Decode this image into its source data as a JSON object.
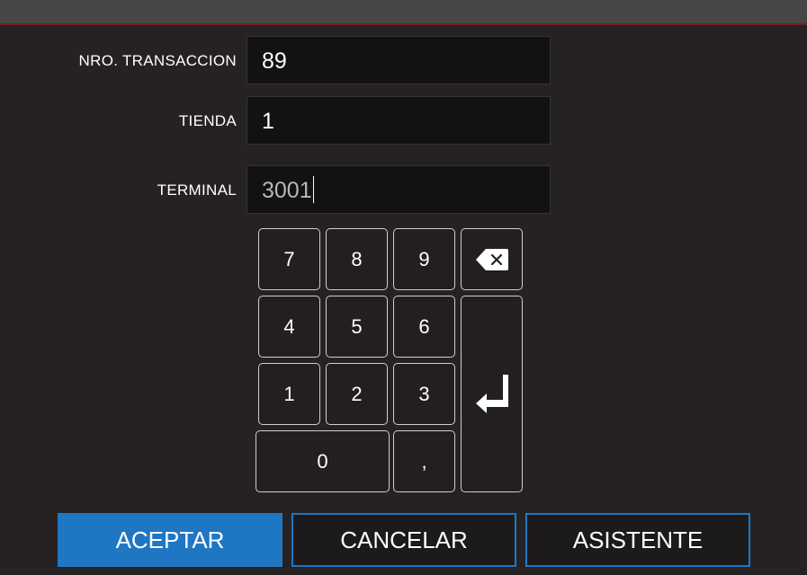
{
  "form": {
    "transaction": {
      "label": "NRO. TRANSACCION",
      "value": "89"
    },
    "store": {
      "label": "TIENDA",
      "value": "1"
    },
    "terminal": {
      "label": "TERMINAL",
      "value": "3001"
    }
  },
  "keypad": {
    "keys": [
      "7",
      "8",
      "9",
      "4",
      "5",
      "6",
      "1",
      "2",
      "3",
      "0",
      ","
    ],
    "backspace_icon": "backspace-icon",
    "enter_icon": "enter-icon"
  },
  "actions": {
    "accept": "ACEPTAR",
    "cancel": "CANCELAR",
    "assistant": "ASISTENTE"
  },
  "colors": {
    "background": "#262224",
    "topbar": "#464646",
    "accent_line": "#7a1c26",
    "input_background": "#121212",
    "primary": "#1f77c4"
  }
}
